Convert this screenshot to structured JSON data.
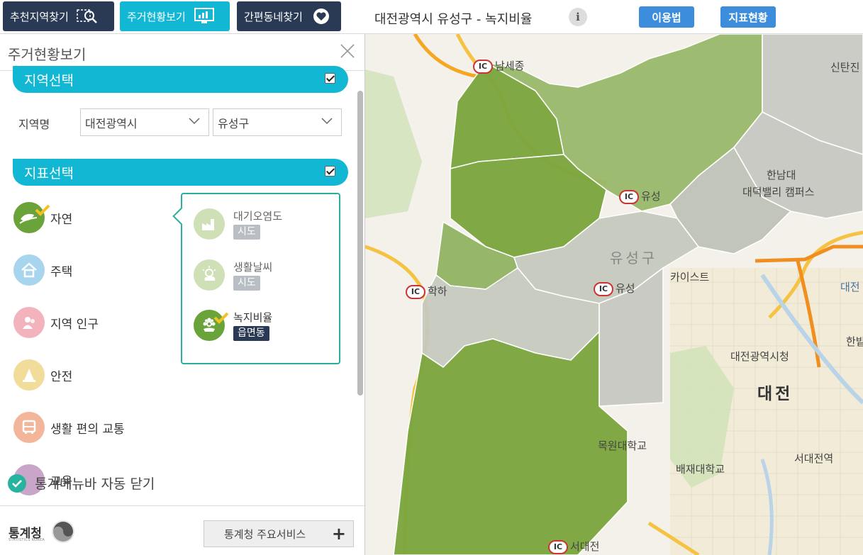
{
  "topbar": {
    "buttons": [
      {
        "label": "추천지역찾기",
        "color": "#2a3a54",
        "icon": "search-region-icon"
      },
      {
        "label": "주거현황보기",
        "color": "#12b8d3",
        "icon": "monitor-chart-icon"
      },
      {
        "label": "간편동네찾기",
        "color": "#2a3a54",
        "icon": "heart-icon"
      }
    ],
    "title": "대전광역시 유성구 - 녹지비율",
    "info_label": "i",
    "help_label": "이용법",
    "indicator_status_label": "지표현황"
  },
  "panel": {
    "title": "주거현황보기",
    "region_section": "지역선택",
    "region_label": "지역명",
    "sido_value": "대전광역시",
    "sigungu_value": "유성구",
    "indicator_section": "지표선택",
    "indicators": [
      {
        "label": "자연",
        "color": "#6aa33a",
        "icon": "nature-leaf-icon",
        "selected": true
      },
      {
        "label": "주택",
        "color": "#a8d5ee",
        "icon": "house-icon"
      },
      {
        "label": "지역 인구",
        "color": "#f3b3bd",
        "icon": "people-icon"
      },
      {
        "label": "안전",
        "color": "#f2dc9a",
        "icon": "cone-icon"
      },
      {
        "label": "생활 편의 교통",
        "color": "#f3b69a",
        "icon": "bus-icon"
      },
      {
        "label": "교육",
        "color": "#c9a6c9",
        "icon": "education-icon"
      }
    ],
    "sub_indicators": [
      {
        "name": "대기오염도",
        "tag": "시도",
        "tag_color": "#b9bec4",
        "icon": "factory-icon"
      },
      {
        "name": "생활날씨",
        "tag": "시도",
        "tag_color": "#b9bec4",
        "icon": "sun-cloud-icon"
      },
      {
        "name": "녹지비율",
        "tag": "읍면동",
        "tag_color": "#2a3a54",
        "icon": "flower-icon",
        "selected": true
      }
    ],
    "auto_close_label": "통계메뉴바 자동 닫기",
    "footer": {
      "brand": "통계청",
      "brand_sub": "STATISTICS KOREA",
      "service_button": "통계청 주요서비스",
      "plus": "+"
    }
  },
  "map": {
    "labels": {
      "ic_nasejong": "남세종",
      "ic_yuseong1": "유성",
      "ic_yuseong2": "유성",
      "ic_hakha": "학하",
      "ic_seodaejeon": "서대전",
      "hannam": "한남대",
      "daedeok_valley": "대덕밸리 캠퍼스",
      "yuseong_gu": "유성구",
      "kaist": "카이스트",
      "daejeon_cityhall": "대전광역시청",
      "daejeon": "대전",
      "mokwon": "목원대학교",
      "paichai": "배재대학교",
      "seodaejeon_station": "서대전역",
      "sintanjin": "신탄진",
      "daejeon_right": "대전",
      "hanbat": "한밭",
      "ic_top_right": "IC",
      "ic_label": "IC"
    },
    "colors": {
      "dark_green": "#7aa63d",
      "mid_green": "#94b766",
      "light_green": "#a9c184",
      "gray": "#c8c8c4"
    }
  }
}
